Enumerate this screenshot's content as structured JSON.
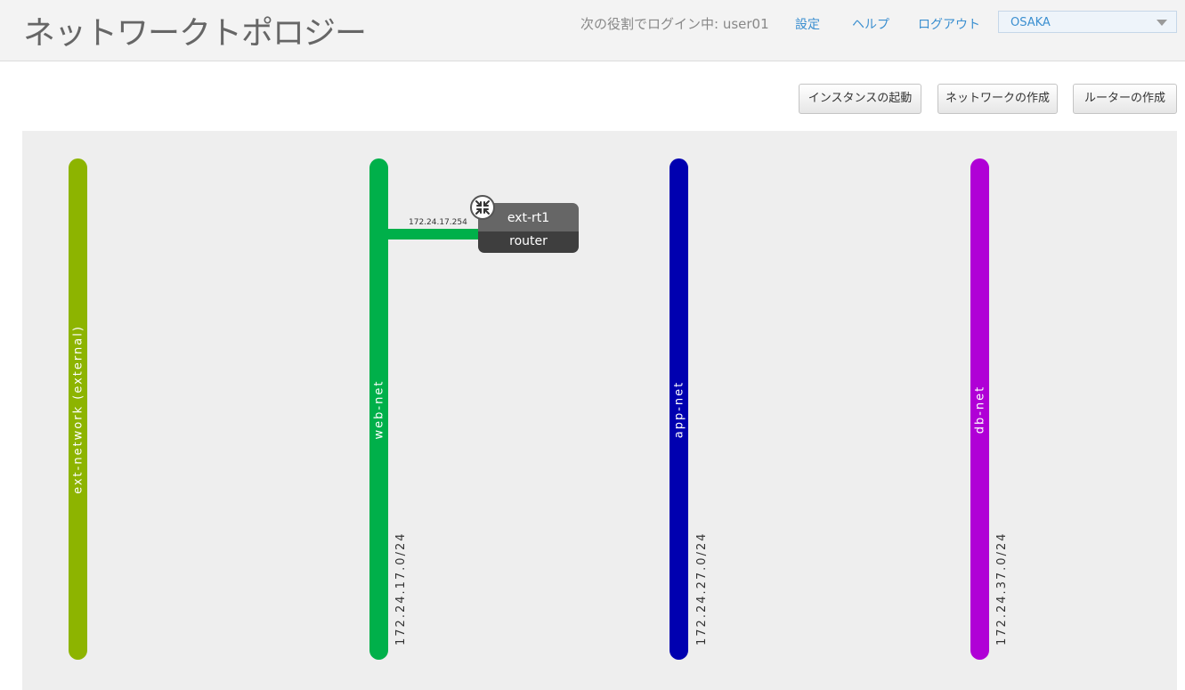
{
  "header": {
    "title": "ネットワークトポロジー",
    "login_text": "次の役割でログイン中: user01",
    "links": {
      "settings": "設定",
      "help": "ヘルプ",
      "logout": "ログアウト"
    },
    "region": "OSAKA"
  },
  "actions": {
    "launch_instance": "インスタンスの起動",
    "create_network": "ネットワークの作成",
    "create_router": "ルーターの作成"
  },
  "networks": [
    {
      "name": "ext-network (external)",
      "cidr": "",
      "color": "#8db400"
    },
    {
      "name": "web-net",
      "cidr": "172.24.17.0/24",
      "color": "#00b04a"
    },
    {
      "name": "app-net",
      "cidr": "172.24.27.0/24",
      "color": "#0000b0"
    },
    {
      "name": "db-net",
      "cidr": "172.24.37.0/24",
      "color": "#b000d6"
    }
  ],
  "router": {
    "name": "ext-rt1",
    "type": "router",
    "port_ip": "172.24.17.254",
    "icon": "router-icon"
  }
}
